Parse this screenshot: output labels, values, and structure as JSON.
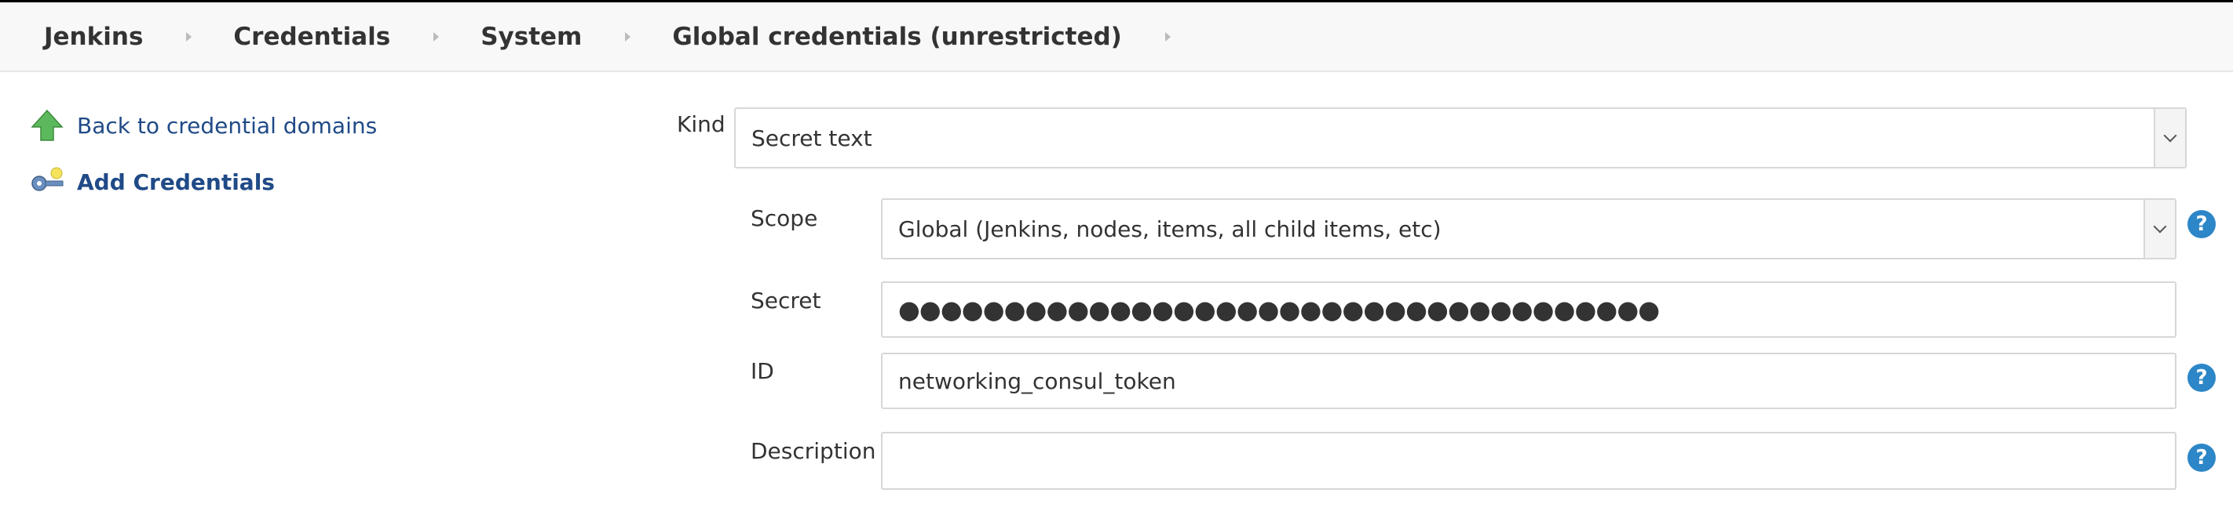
{
  "breadcrumb": {
    "items": [
      {
        "label": "Jenkins"
      },
      {
        "label": "Credentials"
      },
      {
        "label": "System"
      },
      {
        "label": "Global credentials (unrestricted)"
      }
    ]
  },
  "sidebar": {
    "items": [
      {
        "label": "Back to credential domains",
        "icon": "up-arrow-icon"
      },
      {
        "label": "Add Credentials",
        "icon": "key-icon"
      }
    ]
  },
  "form": {
    "kind": {
      "label": "Kind",
      "value": "Secret text"
    },
    "scope": {
      "label": "Scope",
      "value": "Global (Jenkins, nodes, items, all child items, etc)"
    },
    "secret": {
      "label": "Secret",
      "value": "●●●●●●●●●●●●●●●●●●●●●●●●●●●●●●●●●●●●"
    },
    "id": {
      "label": "ID",
      "value": "networking_consul_token"
    },
    "description": {
      "label": "Description",
      "value": ""
    }
  },
  "colors": {
    "link": "#204a87",
    "help": "#2c86c7",
    "arrow_green": "#5cb85c",
    "key_blue": "#6a8fbf"
  }
}
